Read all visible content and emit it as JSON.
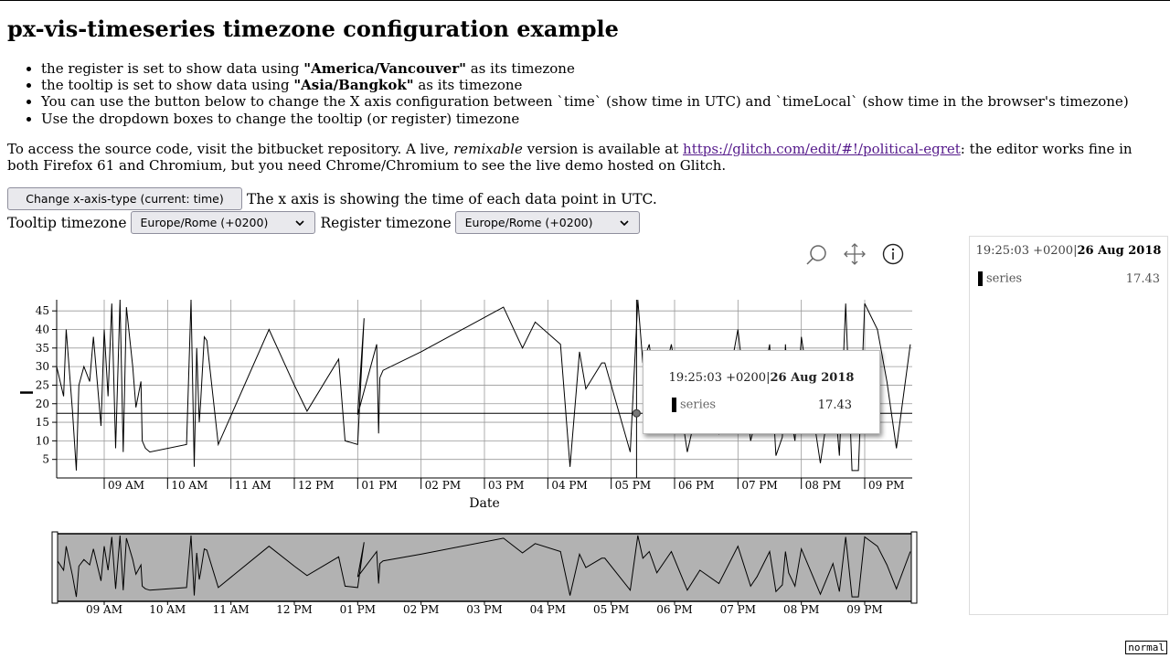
{
  "page": {
    "title": "px-vis-timeseries timezone configuration example",
    "bullets": [
      {
        "before": "the register is set to show data using ",
        "bold": "\"America/Vancouver\"",
        "after": " as its timezone"
      },
      {
        "before": "the tooltip is set to show data using ",
        "bold": "\"Asia/Bangkok\"",
        "after": " as its timezone"
      },
      {
        "before": "You can use the button below to change the X axis configuration between `time` (show time in UTC) and `timeLocal` (show time in the browser's timezone)",
        "bold": "",
        "after": ""
      },
      {
        "before": "Use the dropdown boxes to change the tooltip (or register) timezone",
        "bold": "",
        "after": ""
      }
    ],
    "source": {
      "before": "To access the source code, visit the bitbucket repository. A live, ",
      "em": "remixable",
      "middle": " version is available at ",
      "link": "https://glitch.com/edit/#!/political-egret",
      "after": ": the editor works fine in both Firefox 61 and Chromium, but you need Chrome/Chromium to see the live demo hosted on Glitch."
    }
  },
  "controls": {
    "axis_button": "Change x-axis-type (current: time)",
    "axis_status": "The x axis is showing the time of each data point in UTC.",
    "tooltip_label": "Tooltip timezone",
    "tooltip_value": "Europe/Rome (+0200)",
    "register_label": "Register timezone",
    "register_value": "Europe/Rome (+0200)"
  },
  "toolbar": [
    "zoom-icon",
    "pan-icon",
    "info-icon"
  ],
  "register": {
    "time": "19:25:03 +0200|",
    "date": "26 Aug 2018",
    "series_name": "series",
    "series_value": "17.43"
  },
  "tooltip": {
    "time": "19:25:03 +0200|",
    "date": "26 Aug 2018",
    "series_name": "series",
    "series_value": "17.43"
  },
  "status_badge": "normal",
  "chart_data": {
    "type": "line",
    "xlabel": "Date",
    "ylabel": "",
    "ylim": [
      0,
      48
    ],
    "xlim": [
      8.25,
      21.75
    ],
    "x_ticks": [
      "09 AM",
      "10 AM",
      "11 AM",
      "12 PM",
      "01 PM",
      "02 PM",
      "03 PM",
      "04 PM",
      "05 PM",
      "06 PM",
      "07 PM",
      "08 PM",
      "09 PM"
    ],
    "y_ticks": [
      5,
      10,
      15,
      20,
      25,
      30,
      35,
      40,
      45
    ],
    "crosshair": {
      "x": 17.4,
      "y": 17.43
    },
    "series": [
      {
        "name": "series",
        "color": "#000000",
        "x": [
          8.25,
          8.36,
          8.4,
          8.5,
          8.56,
          8.6,
          8.68,
          8.77,
          8.83,
          8.95,
          9.0,
          9.06,
          9.12,
          9.18,
          9.25,
          9.3,
          9.35,
          9.45,
          9.5,
          9.58,
          9.6,
          9.65,
          9.72,
          10.3,
          10.37,
          10.42,
          10.46,
          10.5,
          10.52,
          10.58,
          10.62,
          10.8,
          11.6,
          12.0,
          12.2,
          12.7,
          12.8,
          13.0,
          13.1,
          13.0,
          13.3,
          13.33,
          13.35,
          13.4,
          14.0,
          15.3,
          15.6,
          15.8,
          16.2,
          16.35,
          16.5,
          16.6,
          16.85,
          16.9,
          17.3,
          17.42,
          17.5,
          17.6,
          17.72,
          17.95,
          18.2,
          18.4,
          18.7,
          19.0,
          19.2,
          19.3,
          19.5,
          19.6,
          19.7,
          19.75,
          19.8,
          19.9,
          20.0,
          20.3,
          20.5,
          20.6,
          20.7,
          20.8,
          20.9,
          21.0,
          21.2,
          21.35,
          21.5,
          21.72
        ],
        "y": [
          30,
          22,
          40,
          18,
          2,
          25,
          30,
          26,
          38,
          14,
          40,
          22,
          47,
          8,
          48,
          7,
          46,
          30,
          19,
          26,
          10,
          8,
          7,
          9,
          48,
          3,
          35,
          15,
          20,
          38,
          37,
          9,
          40,
          25,
          18,
          32,
          10,
          9,
          43,
          17,
          36,
          12,
          27,
          29,
          34,
          46,
          35,
          42,
          36,
          3,
          34,
          24,
          31,
          31,
          7,
          48,
          31,
          36,
          20,
          36,
          7,
          22,
          12,
          40,
          10,
          17,
          36,
          6,
          11,
          36,
          20,
          10,
          38,
          4,
          27,
          6,
          47,
          2,
          2,
          47,
          40,
          26,
          8,
          36
        ]
      }
    ]
  }
}
